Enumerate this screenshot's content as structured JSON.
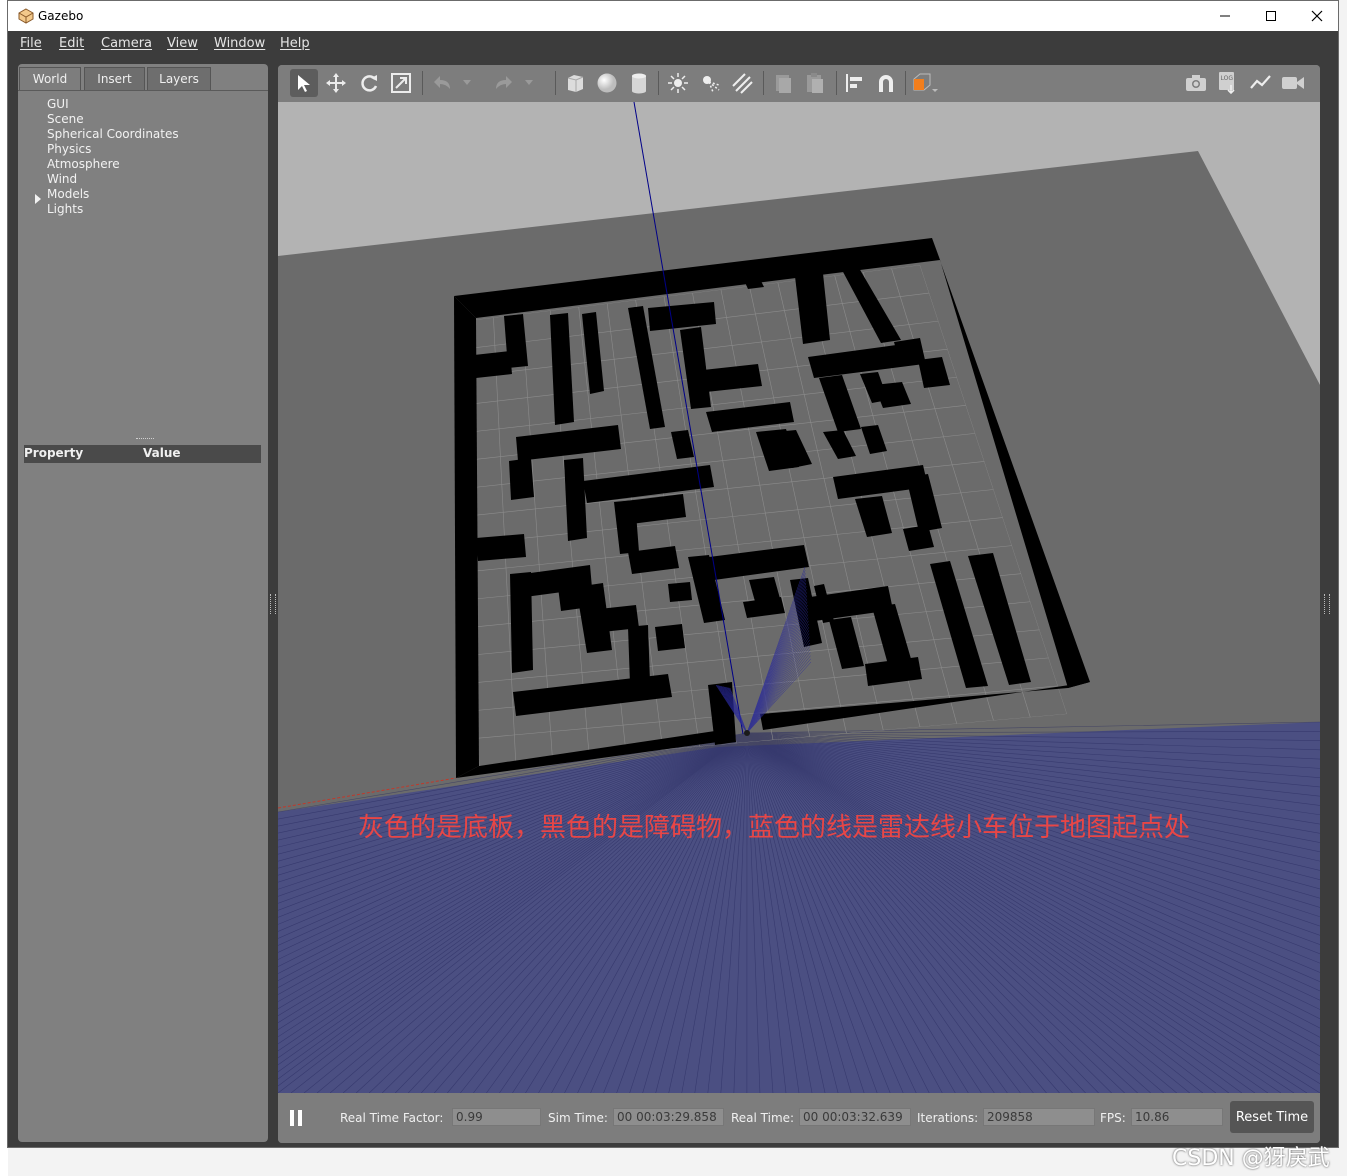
{
  "window": {
    "title": "Gazebo"
  },
  "menu": [
    "File",
    "Edit",
    "Camera",
    "View",
    "Window",
    "Help"
  ],
  "left_panel": {
    "tabs": [
      "World",
      "Insert",
      "Layers"
    ],
    "tree": [
      "GUI",
      "Scene",
      "Spherical Coordinates",
      "Physics",
      "Atmosphere",
      "Wind",
      "Models",
      "Lights"
    ],
    "property_headers": {
      "property": "Property",
      "value": "Value"
    }
  },
  "toolbar": {
    "icons": [
      "select-arrow-icon",
      "translate-icon",
      "rotate-icon",
      "scale-icon",
      "undo-icon",
      "redo-icon",
      "box-icon",
      "sphere-icon",
      "cylinder-icon",
      "point-light-icon",
      "spot-light-icon",
      "directional-light-icon",
      "copy-icon",
      "paste-icon",
      "align-icon",
      "snap-icon",
      "view-angle-icon",
      "screenshot-icon",
      "log-icon",
      "plot-icon",
      "video-record-icon"
    ]
  },
  "scene": {
    "annotation": "灰色的是底板，黑色的是障碍物，蓝色的线是雷达线小车位于地图起点处",
    "colors": {
      "ground": "#6b6b6b",
      "sky": "#b3b3b3",
      "walls": "#000000",
      "laser": "#1a1a8c"
    }
  },
  "status_bar": {
    "real_time_factor_label": "Real Time Factor:",
    "real_time_factor": "0.99",
    "sim_time_label": "Sim Time:",
    "sim_time": "00 00:03:29.858",
    "real_time_label": "Real Time:",
    "real_time": "00 00:03:32.639",
    "iterations_label": "Iterations:",
    "iterations": "209858",
    "fps_label": "FPS:",
    "fps": "10.86",
    "reset_button": "Reset Time"
  },
  "watermark": "CSDN @犽戾武"
}
